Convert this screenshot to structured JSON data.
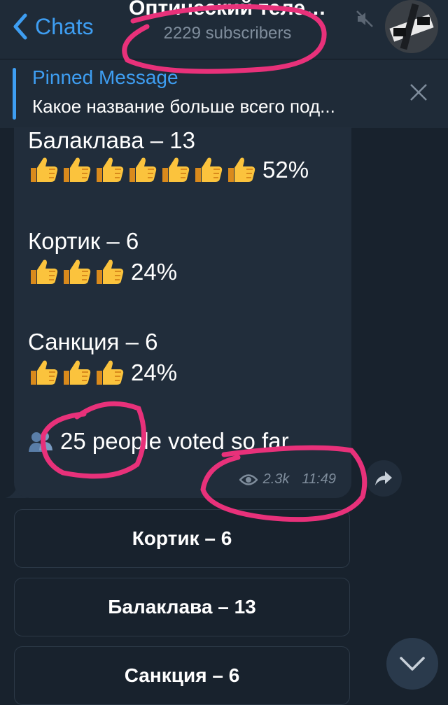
{
  "header": {
    "back_label": "Chats",
    "title": "Оптический теле…",
    "subscribers": "2229 subscribers",
    "mute_icon": "muted-speaker-icon"
  },
  "pinned": {
    "title": "Pinned Message",
    "text": "Какое название больше всего под..."
  },
  "message": {
    "options": [
      {
        "label": "Балаклава – 13",
        "thumbs": 7,
        "percent": "52%"
      },
      {
        "label": "Кортик – 6",
        "thumbs": 3,
        "percent": "24%"
      },
      {
        "label": "Санкция – 6",
        "thumbs": 3,
        "percent": "24%"
      }
    ],
    "voters_text": "25 people voted so far.",
    "views": "2.3k",
    "time": "11:49"
  },
  "buttons": [
    {
      "label": "Кортик – 6"
    },
    {
      "label": "Балаклава – 13"
    },
    {
      "label": "Санкция – 6"
    }
  ],
  "colors": {
    "background": "#18222d",
    "header": "#1f2b38",
    "bubble": "#212d3b",
    "accent": "#3e9ef2",
    "muted_text": "#7f8d9c",
    "annotation": "#e8317a"
  }
}
